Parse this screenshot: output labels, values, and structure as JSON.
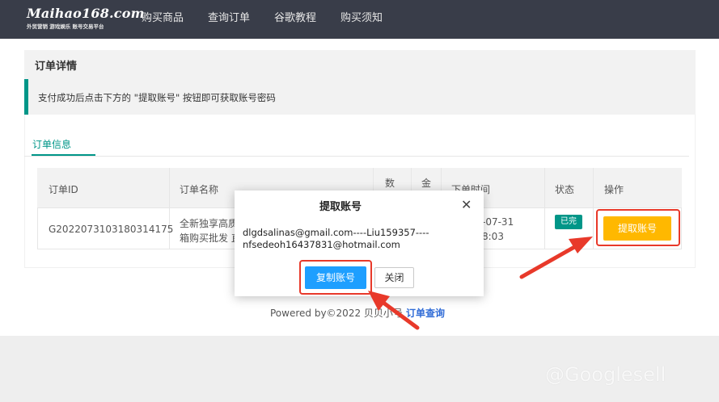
{
  "header": {
    "logo_main": "Maihao168.com",
    "logo_sub": "外贸营销 游戏娱乐 账号交易平台",
    "nav": [
      "购买商品",
      "查询订单",
      "谷歌教程",
      "购买须知"
    ]
  },
  "order_panel": {
    "title": "订单详情",
    "notice": "支付成功后点击下方的 \"提取账号\" 按钮即可获取账号密码",
    "tab": "订单信息"
  },
  "table": {
    "headers": [
      "订单ID",
      "订单名称",
      "数",
      "金",
      "下单时间",
      "状态",
      "操作"
    ],
    "row": {
      "order_id": "G2022073103180314175",
      "name_line1": "全新独享高质",
      "name_line2": "箱购买批发 直",
      "time_line1": "-07-31",
      "time_line2": "8:03",
      "status": "已完",
      "action": "提取账号"
    }
  },
  "footer": {
    "powered": "Powered by©2022 贝贝小号",
    "link": "订单查询"
  },
  "modal": {
    "title": "提取账号",
    "close_glyph": "✕",
    "content": "dlgdsalinas@gmail.com----Liu159357----nfsedeoh16437831@hotmail.com",
    "copy_label": "复制账号",
    "close_label": "关闭"
  },
  "watermark": "@Googlesell",
  "colors": {
    "nav_bg": "#393d49",
    "teal": "#009688",
    "fetch_button": "#ffb800",
    "copy_button": "#1e9fff",
    "annotation_red": "#e8392a"
  }
}
